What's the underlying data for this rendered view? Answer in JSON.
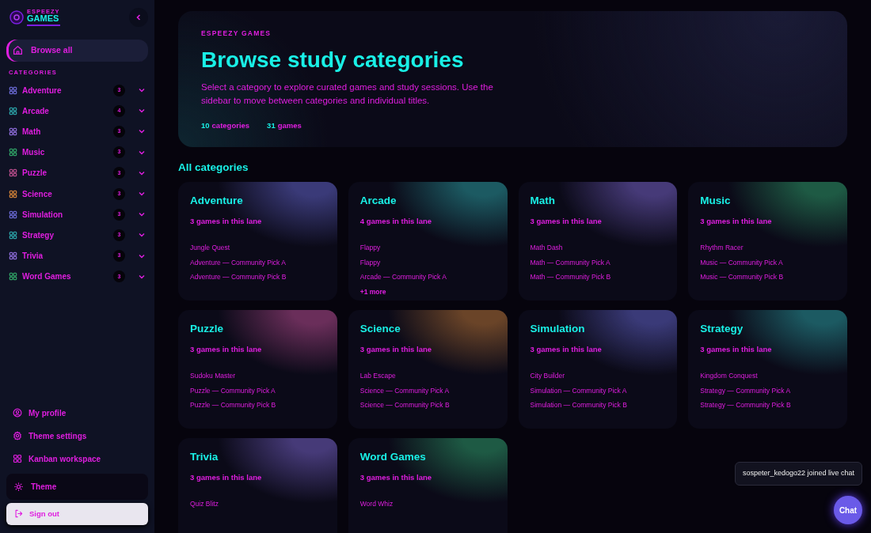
{
  "brand": {
    "eyebrow": "ESPEEZY",
    "name": "GAMES",
    "collapse_expanded": true
  },
  "sidebar": {
    "browse_all": {
      "label": "Browse all",
      "selected": true
    },
    "section_label": "CATEGORIES",
    "categories": [
      {
        "name": "Adventure",
        "count": "3",
        "color": "#6464c8",
        "expanded": false
      },
      {
        "name": "Arcade",
        "count": "4",
        "color": "#2a9aa0",
        "expanded": false
      },
      {
        "name": "Math",
        "count": "3",
        "color": "#8466cc",
        "expanded": false
      },
      {
        "name": "Music",
        "count": "3",
        "color": "#2e9a62",
        "expanded": false
      },
      {
        "name": "Puzzle",
        "count": "3",
        "color": "#b04a86",
        "expanded": false
      },
      {
        "name": "Science",
        "count": "3",
        "color": "#c47a36",
        "expanded": false
      },
      {
        "name": "Simulation",
        "count": "3",
        "color": "#6464c8",
        "expanded": false
      },
      {
        "name": "Strategy",
        "count": "3",
        "color": "#2a9aa0",
        "expanded": false
      },
      {
        "name": "Trivia",
        "count": "3",
        "color": "#8466cc",
        "expanded": false
      },
      {
        "name": "Word Games",
        "count": "3",
        "color": "#2e9a62",
        "expanded": false
      }
    ],
    "footer_links": [
      {
        "label": "My profile",
        "kind": "profile"
      },
      {
        "label": "Theme settings",
        "kind": "settings"
      },
      {
        "label": "Kanban workspace",
        "kind": "grid"
      }
    ],
    "theme_button": "Theme",
    "sign_out": "Sign out"
  },
  "hero": {
    "eyebrow": "ESPEEZY GAMES",
    "title": "Browse study categories",
    "description": "Select a category to explore curated games and study sessions. Use the sidebar to move between categories and individual titles.",
    "stats": [
      {
        "value": "10",
        "label": "categories"
      },
      {
        "value": "31",
        "label": "games"
      }
    ]
  },
  "section_title": "All categories",
  "cards": [
    {
      "title": "Adventure",
      "subtitle": "3 games in this lane",
      "color": "#3a3a78",
      "games": [
        "Jungle Quest",
        "Adventure — Community Pick A",
        "Adventure — Community Pick B"
      ]
    },
    {
      "title": "Arcade",
      "subtitle": "4 games in this lane",
      "color": "#1c5a62",
      "games": [
        "Flappy",
        "Flappy",
        "Arcade — Community Pick A"
      ],
      "more": "+1 more"
    },
    {
      "title": "Math",
      "subtitle": "3 games in this lane",
      "color": "#463a78",
      "games": [
        "Math Dash",
        "Math — Community Pick A",
        "Math — Community Pick B"
      ]
    },
    {
      "title": "Music",
      "subtitle": "3 games in this lane",
      "color": "#1e5a44",
      "games": [
        "Rhythm Racer",
        "Music — Community Pick A",
        "Music — Community Pick B"
      ]
    },
    {
      "title": "Puzzle",
      "subtitle": "3 games in this lane",
      "color": "#6a2e5a",
      "games": [
        "Sudoku Master",
        "Puzzle — Community Pick A",
        "Puzzle — Community Pick B"
      ]
    },
    {
      "title": "Science",
      "subtitle": "3 games in this lane",
      "color": "#6a4428",
      "games": [
        "Lab Escape",
        "Science — Community Pick A",
        "Science — Community Pick B"
      ]
    },
    {
      "title": "Simulation",
      "subtitle": "3 games in this lane",
      "color": "#3a3a78",
      "games": [
        "City Builder",
        "Simulation — Community Pick A",
        "Simulation — Community Pick B"
      ]
    },
    {
      "title": "Strategy",
      "subtitle": "3 games in this lane",
      "color": "#1c5a62",
      "games": [
        "Kingdom Conquest",
        "Strategy — Community Pick A",
        "Strategy — Community Pick B"
      ]
    },
    {
      "title": "Trivia",
      "subtitle": "3 games in this lane",
      "color": "#463a78",
      "games": [
        "Quiz Blitz"
      ]
    },
    {
      "title": "Word Games",
      "subtitle": "3 games in this lane",
      "color": "#1e5a44",
      "games": [
        "Word Whiz"
      ]
    }
  ],
  "toast": "sospeter_kedogo22 joined live chat",
  "chat_button": "Chat"
}
